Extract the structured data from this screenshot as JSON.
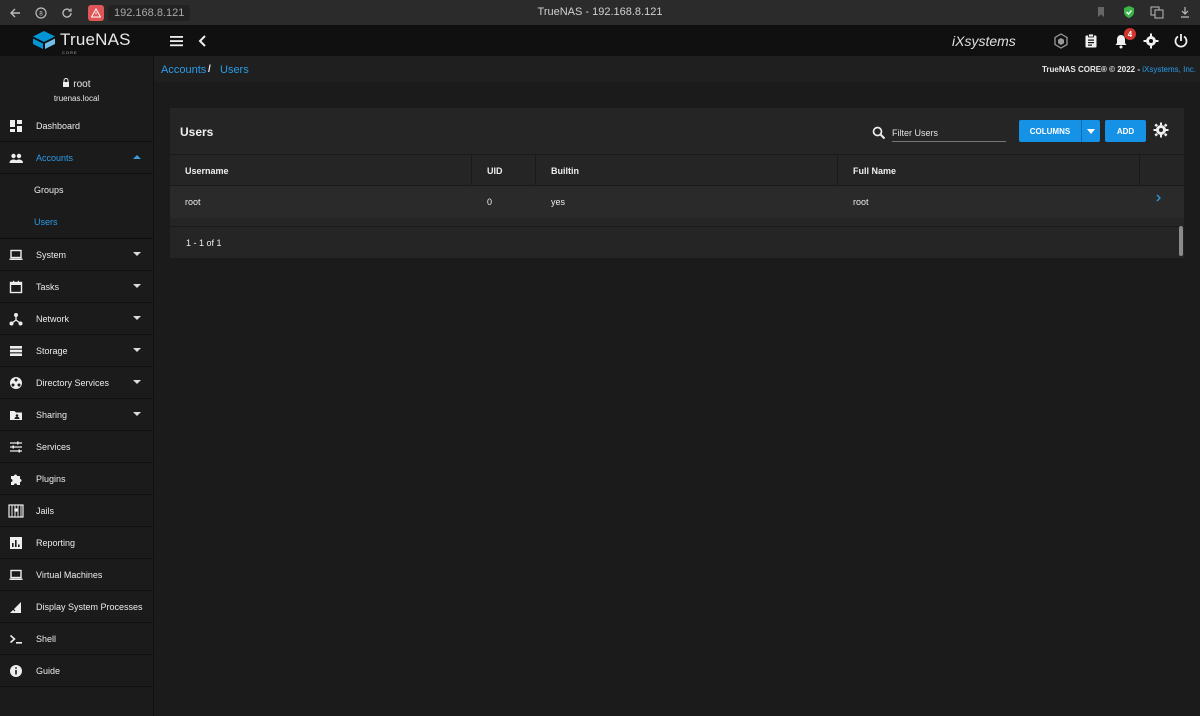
{
  "browser": {
    "address": "192.168.8.121",
    "tab_title": "TrueNAS - 192.168.8.121"
  },
  "header": {
    "logo_text": "TrueNAS",
    "logo_sub": "CORE",
    "vendor_logo": "iXsystems",
    "alert_count": "4"
  },
  "sidebar": {
    "user": "root",
    "host": "truenas.local",
    "items": [
      {
        "label": "Dashboard",
        "icon": "dashboard-icon"
      },
      {
        "label": "Accounts",
        "icon": "accounts-icon"
      },
      {
        "label": "System",
        "icon": "system-icon"
      },
      {
        "label": "Tasks",
        "icon": "tasks-icon"
      },
      {
        "label": "Network",
        "icon": "network-icon"
      },
      {
        "label": "Storage",
        "icon": "storage-icon"
      },
      {
        "label": "Directory Services",
        "icon": "directory-services-icon"
      },
      {
        "label": "Sharing",
        "icon": "sharing-icon"
      },
      {
        "label": "Services",
        "icon": "services-icon"
      },
      {
        "label": "Plugins",
        "icon": "plugins-icon"
      },
      {
        "label": "Jails",
        "icon": "jails-icon"
      },
      {
        "label": "Reporting",
        "icon": "reporting-icon"
      },
      {
        "label": "Virtual Machines",
        "icon": "virtual-machines-icon"
      },
      {
        "label": "Display System Processes",
        "icon": "processes-icon"
      },
      {
        "label": "Shell",
        "icon": "shell-icon"
      },
      {
        "label": "Guide",
        "icon": "guide-icon"
      }
    ],
    "accounts_sub": [
      {
        "label": "Groups"
      },
      {
        "label": "Users"
      }
    ]
  },
  "breadcrumb": {
    "parent": "Accounts",
    "separator": "/",
    "current": "Users"
  },
  "footer_copy": {
    "text": "TrueNAS CORE® © 2022 - ",
    "link": "iXsystems, Inc."
  },
  "users_card": {
    "title": "Users",
    "search_placeholder": "Filter Users",
    "columns_label": "COLUMNS",
    "add_label": "ADD",
    "headers": [
      "Username",
      "UID",
      "Builtin",
      "Full Name"
    ],
    "rows": [
      {
        "username": "root",
        "uid": "0",
        "builtin": "yes",
        "full_name": "root"
      }
    ],
    "pager": "1 - 1 of 1"
  },
  "colors": {
    "accent": "#1592e6",
    "link": "#2a9ce8",
    "badge": "#d0342c"
  }
}
